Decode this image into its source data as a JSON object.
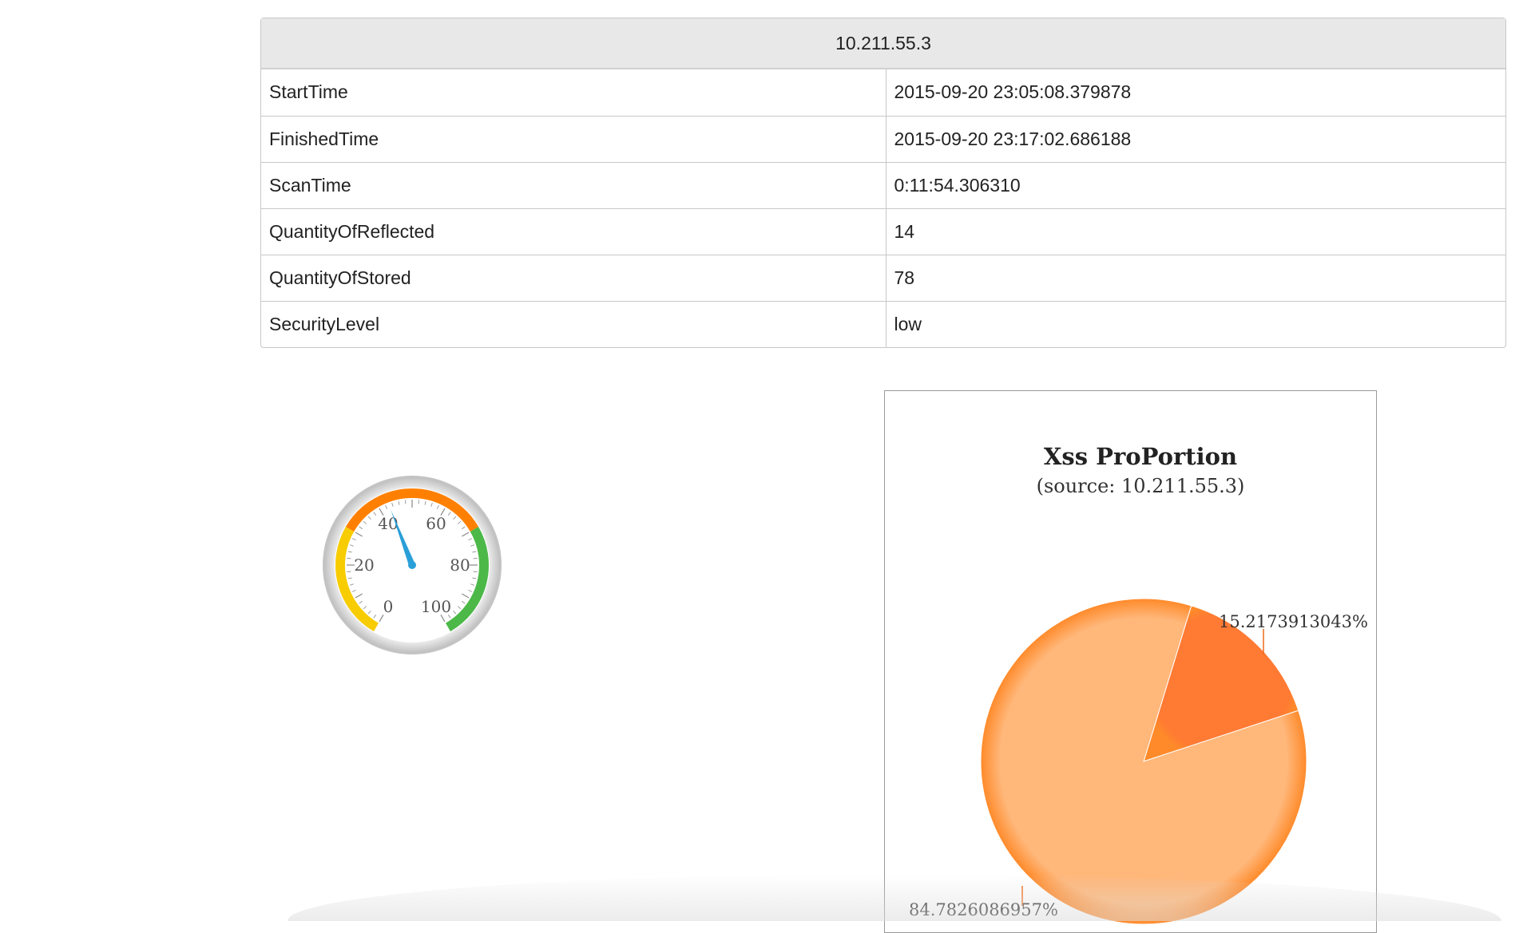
{
  "report": {
    "host": "10.211.55.3",
    "rows": [
      {
        "key": "StartTime",
        "value": "2015-09-20 23:05:08.379878"
      },
      {
        "key": "FinishedTime",
        "value": "2015-09-20 23:17:02.686188"
      },
      {
        "key": "ScanTime",
        "value": "0:11:54.306310"
      },
      {
        "key": "QuantityOfReflected",
        "value": "14"
      },
      {
        "key": "QuantityOfStored",
        "value": "78"
      },
      {
        "key": "SecurityLevel",
        "value": "low"
      }
    ]
  },
  "gauge": {
    "min": 0,
    "max": 100,
    "value": 43,
    "tick_labels": [
      "0",
      "20",
      "40",
      "60",
      "80",
      "100"
    ],
    "bands": [
      {
        "from": 0,
        "to": 30,
        "color": "#f7cc00"
      },
      {
        "from": 30,
        "to": 70,
        "color": "#ff8000"
      },
      {
        "from": 70,
        "to": 100,
        "color": "#4cb848"
      }
    ],
    "needle_color": "#2a9fd8"
  },
  "chart_data": {
    "type": "pie",
    "title": "Xss ProPortion",
    "subtitle": "(source: 10.211.55.3)",
    "slices": [
      {
        "label": "15.2173913043%",
        "value": 15.2173913043,
        "color": "#ff7a33"
      },
      {
        "label": "84.7826086957%",
        "value": 84.7826086957,
        "color": "#ffb77a"
      }
    ]
  }
}
